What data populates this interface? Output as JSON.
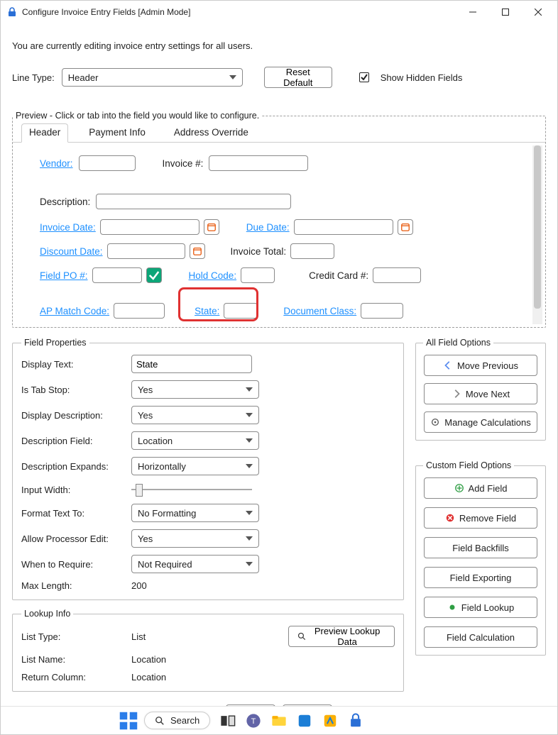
{
  "window": {
    "title": "Configure Invoice Entry Fields [Admin Mode]"
  },
  "intro": "You are currently editing invoice entry settings for all users.",
  "lineType": {
    "label": "Line Type:",
    "value": "Header"
  },
  "resetBtn": "Reset Default",
  "showHidden": {
    "label": "Show Hidden Fields",
    "checked": true
  },
  "preview": {
    "legend": "Preview - Click or tab into the field you would like to configure.",
    "tabs": [
      "Header",
      "Payment Info",
      "Address Override"
    ],
    "activeTab": 0,
    "fields": {
      "vendor": "Vendor:",
      "invoiceNo": "Invoice #:",
      "description": "Description:",
      "invoiceDate": "Invoice Date:",
      "dueDate": "Due Date:",
      "discountDate": "Discount Date:",
      "invoiceTotal": "Invoice Total:",
      "fieldPO": "Field PO #:",
      "holdCode": "Hold Code:",
      "creditCard": "Credit Card #:",
      "apMatch": "AP Match Code:",
      "state": "State:",
      "docClass": "Document Class:"
    }
  },
  "fieldProps": {
    "legend": "Field Properties",
    "displayText": {
      "label": "Display Text:",
      "value": "State"
    },
    "isTabStop": {
      "label": "Is Tab Stop:",
      "value": "Yes"
    },
    "displayDesc": {
      "label": "Display Description:",
      "value": "Yes"
    },
    "descField": {
      "label": "Description Field:",
      "value": "Location"
    },
    "descExpands": {
      "label": "Description Expands:",
      "value": "Horizontally"
    },
    "inputWidth": {
      "label": "Input Width:"
    },
    "formatText": {
      "label": "Format Text To:",
      "value": "No Formatting"
    },
    "allowProc": {
      "label": "Allow Processor Edit:",
      "value": "Yes"
    },
    "whenReq": {
      "label": "When to Require:",
      "value": "Not Required"
    },
    "maxLen": {
      "label": "Max Length:",
      "value": "200"
    }
  },
  "allFieldOptions": {
    "legend": "All Field Options",
    "movePrev": "Move Previous",
    "moveNext": "Move Next",
    "manageCalc": "Manage Calculations"
  },
  "customFieldOptions": {
    "legend": "Custom Field Options",
    "addField": "Add Field",
    "removeField": "Remove Field",
    "backfills": "Field Backfills",
    "exporting": "Field Exporting",
    "lookup": "Field Lookup",
    "calculation": "Field Calculation"
  },
  "lookupInfo": {
    "legend": "Lookup Info",
    "previewBtn": "Preview Lookup Data",
    "listType": {
      "label": "List Type:",
      "value": "List"
    },
    "listName": {
      "label": "List Name:",
      "value": "Location"
    },
    "returnCol": {
      "label": "Return Column:",
      "value": "Location"
    }
  },
  "taskbar": {
    "search": "Search"
  }
}
